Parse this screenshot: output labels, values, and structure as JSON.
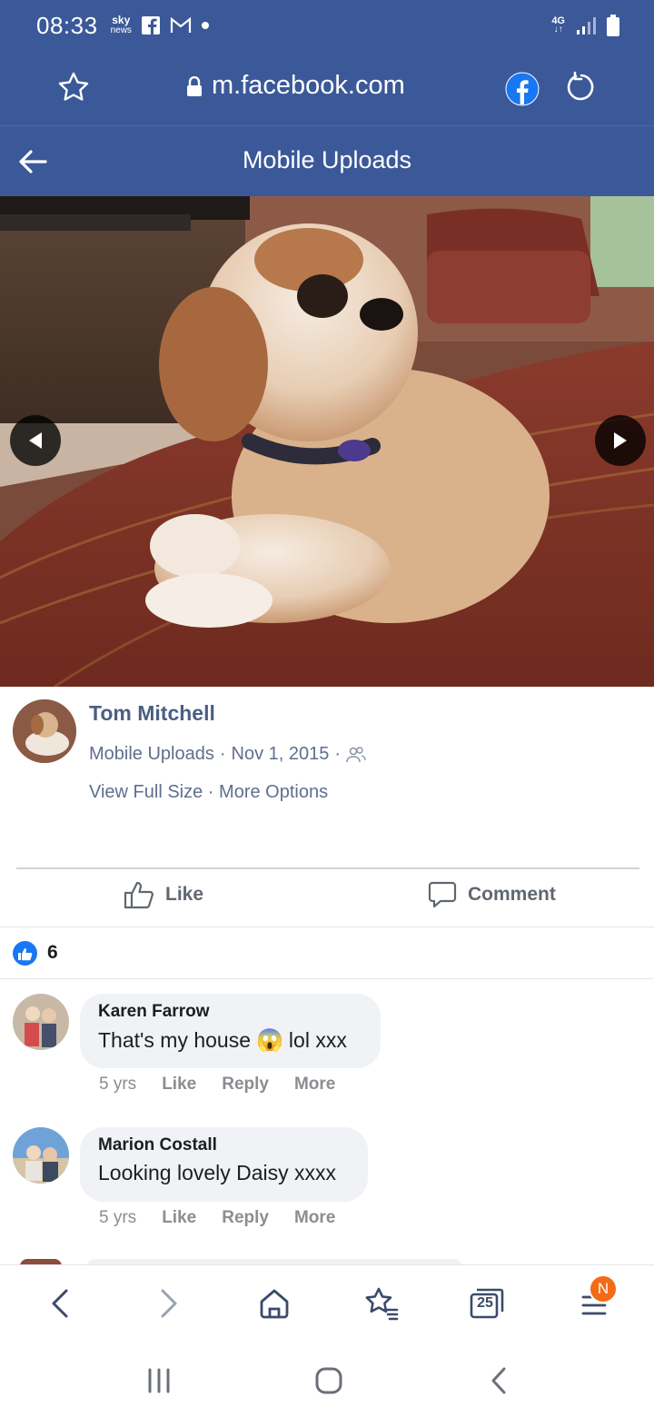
{
  "status_bar": {
    "time": "08:33",
    "sky_line1": "sky",
    "sky_line2": "news",
    "network": "4G"
  },
  "browser": {
    "url": "m.facebook.com"
  },
  "header": {
    "title": "Mobile Uploads"
  },
  "post": {
    "author": "Tom Mitchell",
    "album": "Mobile Uploads",
    "sep1": "·",
    "date": "Nov 1, 2015",
    "sep2": "·",
    "view_full_size": "View Full Size",
    "sep3": "·",
    "more_options": "More Options"
  },
  "actions": {
    "like": "Like",
    "comment": "Comment"
  },
  "reactions": {
    "count": "6"
  },
  "comments": [
    {
      "name": "Karen Farrow",
      "text_before": "That's my house",
      "emoji": "😱",
      "text_after": "lol xxx",
      "age": "5 yrs",
      "like": "Like",
      "reply": "Reply",
      "more": "More"
    },
    {
      "name": "Marion Costall",
      "text_before": "Looking lovely Daisy xxxx",
      "age": "5 yrs",
      "like": "Like",
      "reply": "Reply",
      "more": "More"
    }
  ],
  "browser_nav": {
    "tabs_count": "25",
    "notification_badge": "N"
  },
  "colors": {
    "facebook_blue": "#3b5998",
    "link_grey": "#5f6f8e",
    "like_blue": "#1877f2",
    "badge_orange": "#f36b16"
  },
  "icons": [
    "star-icon",
    "lock-icon",
    "facebook-icon",
    "refresh-icon",
    "back-arrow-icon",
    "prev-photo-icon",
    "next-photo-icon",
    "friends-icon",
    "thumbs-up-icon",
    "comment-icon",
    "like-reaction-icon",
    "home-icon",
    "bookmarks-icon",
    "tabs-icon",
    "menu-icon"
  ]
}
